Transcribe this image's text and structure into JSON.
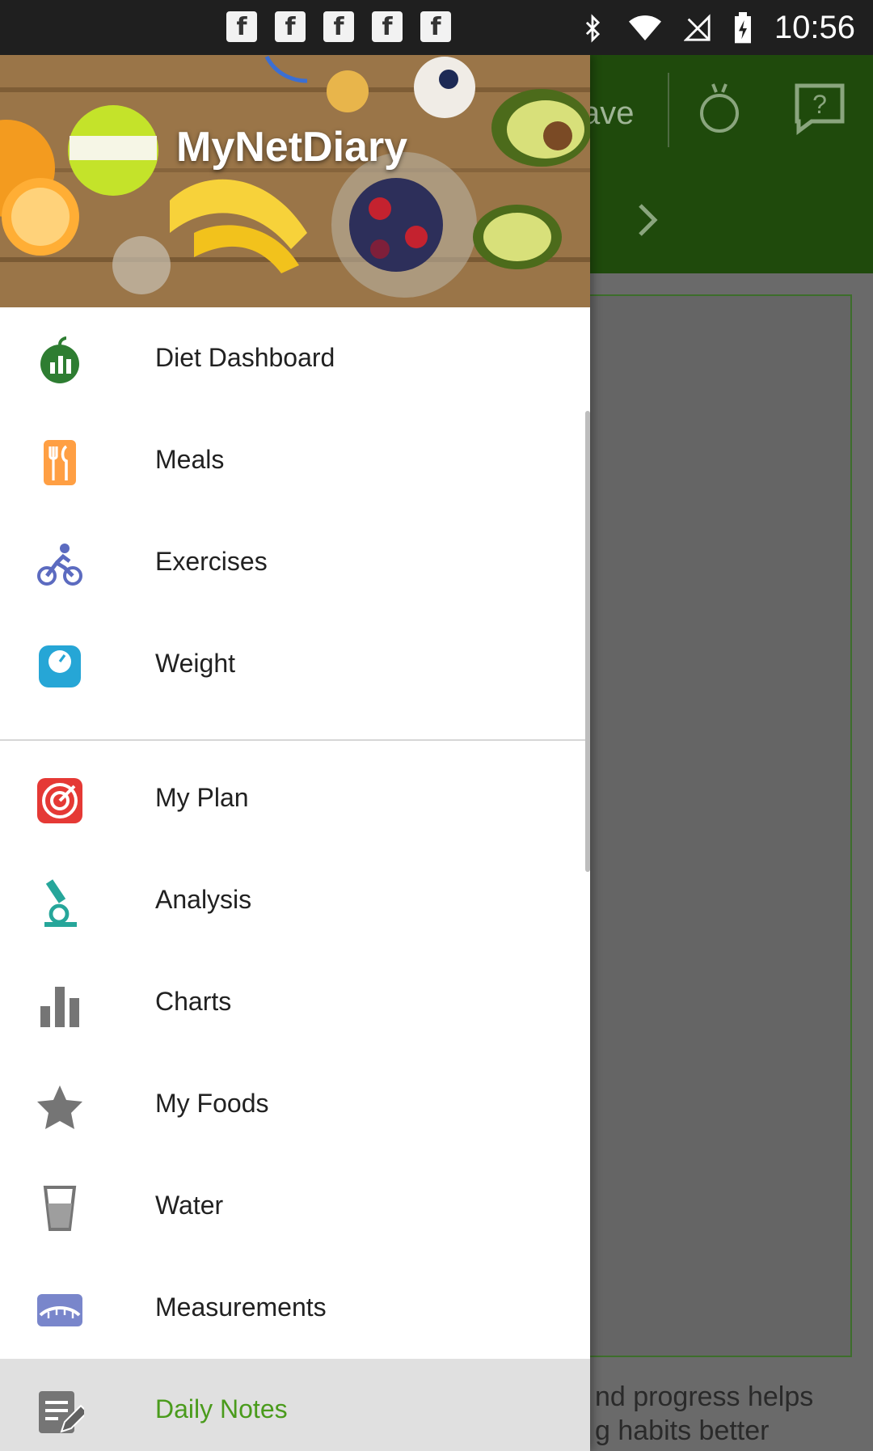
{
  "status_bar": {
    "time": "10:56",
    "notification_icons": [
      "facebook-icon",
      "facebook-icon",
      "facebook-icon",
      "facebook-icon",
      "facebook-icon"
    ],
    "system_icons": [
      "bluetooth-icon",
      "wifi-icon",
      "no-signal-icon",
      "battery-charging-icon"
    ]
  },
  "drawer": {
    "title": "MyNetDiary",
    "items": [
      {
        "label": "Diet Dashboard",
        "icon": "dashboard-apple-icon"
      },
      {
        "label": "Meals",
        "icon": "fork-knife-icon"
      },
      {
        "label": "Exercises",
        "icon": "cyclist-icon"
      },
      {
        "label": "Weight",
        "icon": "scale-icon"
      },
      {
        "label": "My Plan",
        "icon": "target-icon"
      },
      {
        "label": "Analysis",
        "icon": "microscope-icon"
      },
      {
        "label": "Charts",
        "icon": "bar-chart-icon"
      },
      {
        "label": "My Foods",
        "icon": "star-icon"
      },
      {
        "label": "Water",
        "icon": "water-glass-icon"
      },
      {
        "label": "Measurements",
        "icon": "tape-measure-icon"
      },
      {
        "label": "Daily Notes",
        "icon": "notes-pencil-icon"
      }
    ],
    "active_item": "Daily Notes"
  },
  "background_app": {
    "toolbar_partial_label": "ave",
    "body_partial_lines": [
      "nd progress helps",
      "g habits better"
    ]
  },
  "colors": {
    "app_bar": "#1f4a0c",
    "active_label": "#4a9b1c",
    "icon_green": "#2e7d32",
    "icon_teal": "#26a69a",
    "icon_red": "#e53935",
    "icon_gray": "#757575"
  }
}
